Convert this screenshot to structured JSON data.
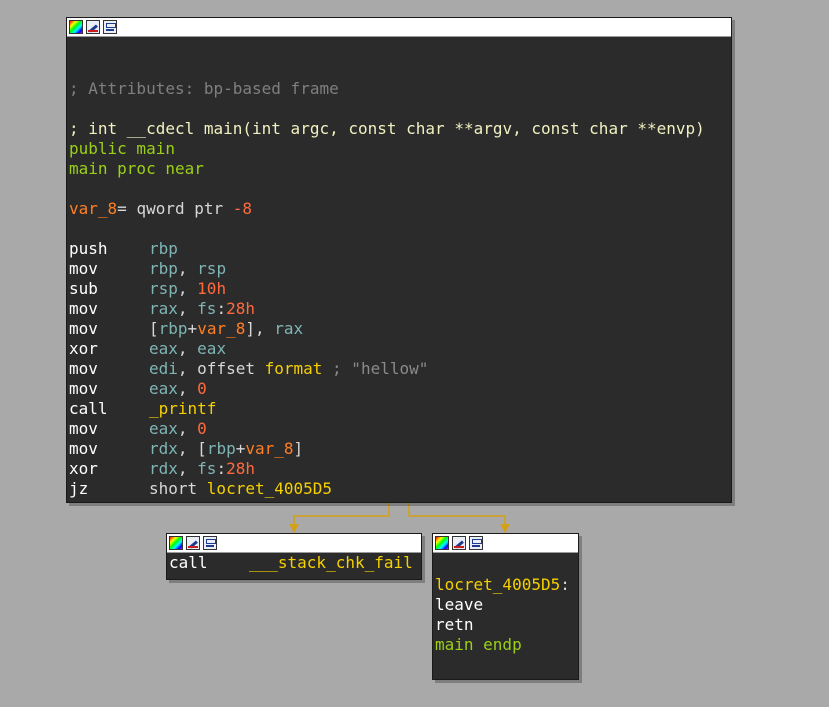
{
  "toolbar_icons": [
    "color-palette-icon",
    "edit-node-icon",
    "graph-view-icon"
  ],
  "colors": {
    "background": "#a9a9a9",
    "node_bg": "#2b2b2b",
    "edge": "#d4a017"
  },
  "main_block": {
    "attributes_comment": "; Attributes: bp-based frame",
    "signature_comment": "; int __cdecl main(int argc, const char **argv, const char **envp)",
    "public_line": "public main",
    "proc_line": "main proc near",
    "var_decl": {
      "name": "var_8",
      "eq": "=",
      "type": " qword ptr ",
      "value": "-8"
    },
    "instructions": {
      "i0": {
        "mnemonic": "push",
        "op1": "rbp"
      },
      "i1": {
        "mnemonic": "mov",
        "op1": "rbp",
        "sep": ", ",
        "op2": "rsp"
      },
      "i2": {
        "mnemonic": "sub",
        "op1": "rsp",
        "sep": ", ",
        "op2": "10h"
      },
      "i3": {
        "mnemonic": "mov",
        "op1": "rax",
        "sep": ", ",
        "seg": "fs",
        "colon": ":",
        "off": "28h"
      },
      "i4": {
        "mnemonic": "mov",
        "lb": "[",
        "base": "rbp",
        "plus": "+",
        "var": "var_8",
        "rb": "]",
        "sep": ", ",
        "op2": "rax"
      },
      "i5": {
        "mnemonic": "xor",
        "op1": "eax",
        "sep": ", ",
        "op2": "eax"
      },
      "i6": {
        "mnemonic": "mov",
        "op1": "edi",
        "sep": ", ",
        "kw": "offset ",
        "sym": "format",
        "comment": " ; \"hellow\""
      },
      "i7": {
        "mnemonic": "mov",
        "op1": "eax",
        "sep": ", ",
        "op2": "0"
      },
      "i8": {
        "mnemonic": "call",
        "target": "_printf"
      },
      "i9": {
        "mnemonic": "mov",
        "op1": "eax",
        "sep": ", ",
        "op2": "0"
      },
      "i10": {
        "mnemonic": "mov",
        "op1": "rdx",
        "sep": ", ",
        "lb": "[",
        "base": "rbp",
        "plus": "+",
        "var": "var_8",
        "rb": "]"
      },
      "i11": {
        "mnemonic": "xor",
        "op1": "rdx",
        "sep": ", ",
        "seg": "fs",
        "colon": ":",
        "off": "28h"
      },
      "i12": {
        "mnemonic": "jz",
        "kw": "short ",
        "target": "locret_4005D5"
      }
    }
  },
  "fail_block": {
    "mnemonic": "call",
    "target": "___stack_chk_fail"
  },
  "ret_block": {
    "label": "locret_4005D5",
    "label_colon": ":",
    "leave": "leave",
    "retn": "retn",
    "endp": "main endp"
  }
}
